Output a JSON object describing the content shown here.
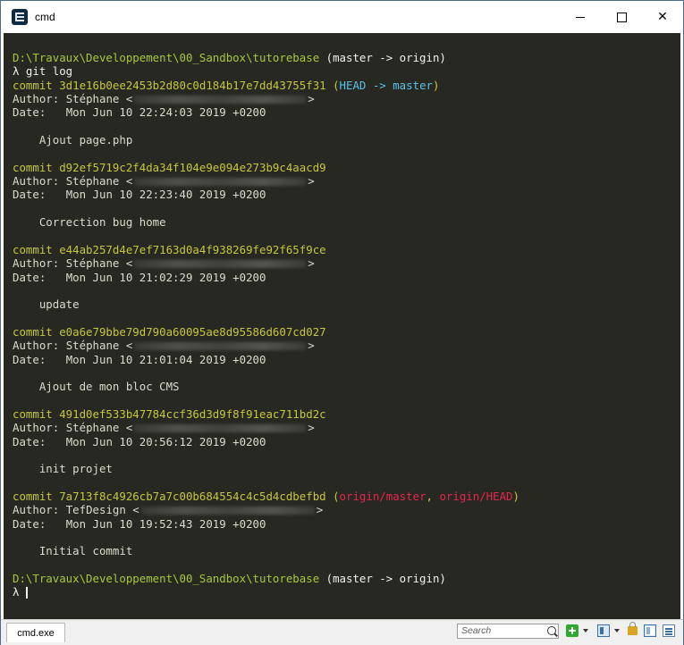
{
  "window": {
    "title": "cmd"
  },
  "prompt": {
    "path": "D:\\Travaux\\Developpement\\00_Sandbox\\tutorebase",
    "branch": " (master -> origin)",
    "symbol": "λ",
    "command": " git log"
  },
  "log": {
    "author_label": "Author: ",
    "date_label": "Date:   ",
    "commit_label": "commit ",
    "commits": [
      {
        "hash": "3d1e16b0ee2453b2d80c0d184b17e7dd43755f31",
        "ref_open": " (",
        "ref1": "HEAD -> master",
        "ref_sep": "",
        "ref2": "",
        "ref_close": ")",
        "author": "Stéphane <",
        "author_end": ">",
        "date": "Mon Jun 10 22:24:03 2019 +0200",
        "message": "    Ajout page.php"
      },
      {
        "hash": "d92ef5719c2f4da34f104e9e094e273b9c4aacd9",
        "ref_open": "",
        "ref1": "",
        "ref_sep": "",
        "ref2": "",
        "ref_close": "",
        "author": "Stéphane <",
        "author_end": ">",
        "date": "Mon Jun 10 22:23:40 2019 +0200",
        "message": "    Correction bug home"
      },
      {
        "hash": "e44ab257d4e7ef7163d0a4f938269fe92f65f9ce",
        "ref_open": "",
        "ref1": "",
        "ref_sep": "",
        "ref2": "",
        "ref_close": "",
        "author": "Stéphane <",
        "author_end": ">",
        "date": "Mon Jun 10 21:02:29 2019 +0200",
        "message": "    update"
      },
      {
        "hash": "e0a6e79bbe79d790a60095ae8d95586d607cd027",
        "ref_open": "",
        "ref1": "",
        "ref_sep": "",
        "ref2": "",
        "ref_close": "",
        "author": "Stéphane <",
        "author_end": ">",
        "date": "Mon Jun 10 21:01:04 2019 +0200",
        "message": "    Ajout de mon bloc CMS"
      },
      {
        "hash": "491d0ef533b47784ccf36d3d9f8f91eac711bd2c",
        "ref_open": "",
        "ref1": "",
        "ref_sep": "",
        "ref2": "",
        "ref_close": "",
        "author": "Stéphane <",
        "author_end": ">",
        "date": "Mon Jun 10 20:56:12 2019 +0200",
        "message": "    init projet"
      },
      {
        "hash": "7a713f8c4926cb7a7c00b684554c4c5d4cdbefbd",
        "ref_open": " (",
        "ref1": "origin/master",
        "ref_sep": ", ",
        "ref2": "origin/HEAD",
        "ref_close": ")",
        "author": "TefDesign <",
        "author_end": ">",
        "date": "Mon Jun 10 19:52:43 2019 +0200",
        "message": "    Initial commit"
      }
    ]
  },
  "status_bar": {
    "tab_label": "cmd.exe",
    "search_placeholder": "Search"
  },
  "colors": {
    "background": "#272822",
    "path": "#a6c93a",
    "commit": "#c7c73c",
    "head_ref": "#58c3e8",
    "origin_ref": "#e8264c"
  },
  "icons": [
    "app-icon",
    "minimize-icon",
    "maximize-icon",
    "close-icon",
    "search-icon",
    "add-console-icon",
    "panes-icon",
    "lock-icon",
    "view-icon",
    "menu-icon"
  ]
}
